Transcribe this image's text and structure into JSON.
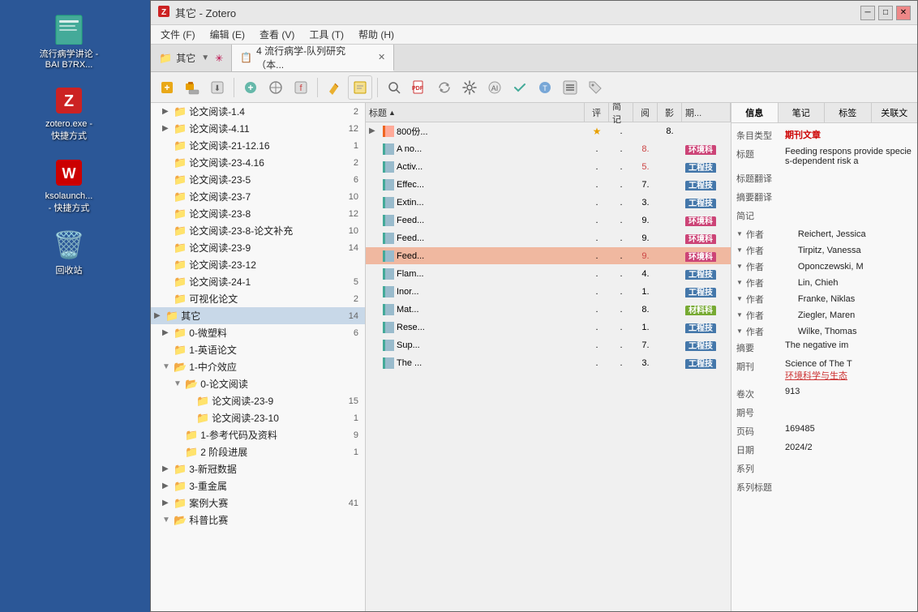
{
  "window": {
    "title": "其它 - Zotero",
    "icon": "Z"
  },
  "menus": [
    {
      "label": "文件 (F)"
    },
    {
      "label": "编辑 (E)"
    },
    {
      "label": "查看 (V)"
    },
    {
      "label": "工具 (T)"
    },
    {
      "label": "帮助 (H)"
    }
  ],
  "tabs": [
    {
      "label": "其它",
      "icon": "📁",
      "active": false,
      "closeable": false,
      "hasDropdown": true
    },
    {
      "label": "4 流行病学-队列研究（本...",
      "icon": "📋",
      "active": true,
      "closeable": true
    }
  ],
  "desktop_icons": [
    {
      "label": "流行病学讲论\n-BAI B7RX...",
      "icon": "📄",
      "color": "#4a7"
    },
    {
      "label": "zotero.exe -\n快捷方式",
      "icon": "Z",
      "special": "zotero"
    },
    {
      "label": "ksolaunch...\n- 快捷方式",
      "icon": "W",
      "special": "wps"
    },
    {
      "label": "回收站",
      "icon": "🗑️"
    }
  ],
  "tree": {
    "items": [
      {
        "level": 1,
        "label": "论文阅读-1.4",
        "count": "2",
        "expanded": false,
        "selected": false,
        "indent": 1
      },
      {
        "level": 1,
        "label": "论文阅读-4.11",
        "count": "12",
        "expanded": false,
        "selected": false,
        "indent": 1
      },
      {
        "level": 1,
        "label": "论文阅读-21-12.16",
        "count": "1",
        "expanded": false,
        "selected": false,
        "indent": 1
      },
      {
        "level": 1,
        "label": "论文阅读-23-4.16",
        "count": "2",
        "expanded": false,
        "selected": false,
        "indent": 1
      },
      {
        "level": 1,
        "label": "论文阅读-23-5",
        "count": "6",
        "expanded": false,
        "selected": false,
        "indent": 1
      },
      {
        "level": 1,
        "label": "论文阅读-23-7",
        "count": "10",
        "expanded": false,
        "selected": false,
        "indent": 1
      },
      {
        "level": 1,
        "label": "论文阅读-23-8",
        "count": "12",
        "expanded": false,
        "selected": false,
        "indent": 1
      },
      {
        "level": 1,
        "label": "论文阅读-23-8-论文补充",
        "count": "10",
        "expanded": false,
        "selected": false,
        "indent": 1
      },
      {
        "level": 1,
        "label": "论文阅读-23-9",
        "count": "14",
        "expanded": false,
        "selected": false,
        "indent": 1
      },
      {
        "level": 1,
        "label": "论文阅读-23-12",
        "count": "",
        "expanded": false,
        "selected": false,
        "indent": 1
      },
      {
        "level": 1,
        "label": "论文阅读-24-1",
        "count": "5",
        "expanded": false,
        "selected": false,
        "indent": 1
      },
      {
        "level": 1,
        "label": "可视化论文",
        "count": "2",
        "expanded": false,
        "selected": false,
        "indent": 1
      },
      {
        "level": 0,
        "label": "其它",
        "count": "14",
        "expanded": false,
        "selected": true,
        "indent": 0
      },
      {
        "level": 1,
        "label": "0-微塑料",
        "count": "6",
        "expanded": false,
        "selected": false,
        "indent": 1
      },
      {
        "level": 1,
        "label": "1-英语论文",
        "count": "",
        "expanded": false,
        "selected": false,
        "indent": 1
      },
      {
        "level": 1,
        "label": "1-中介效应",
        "count": "",
        "expanded": true,
        "selected": false,
        "indent": 1
      },
      {
        "level": 2,
        "label": "0-论文阅读",
        "count": "",
        "expanded": true,
        "selected": false,
        "indent": 2
      },
      {
        "level": 3,
        "label": "论文阅读-23-9",
        "count": "15",
        "expanded": false,
        "selected": false,
        "indent": 3
      },
      {
        "level": 3,
        "label": "论文阅读-23-10",
        "count": "1",
        "expanded": false,
        "selected": false,
        "indent": 3
      },
      {
        "level": 2,
        "label": "1-参考代码及资料",
        "count": "9",
        "expanded": false,
        "selected": false,
        "indent": 2
      },
      {
        "level": 2,
        "label": "2 阶段进展",
        "count": "1",
        "expanded": false,
        "selected": false,
        "indent": 2
      },
      {
        "level": 1,
        "label": "3-新冠数据",
        "count": "",
        "expanded": false,
        "selected": false,
        "indent": 1
      },
      {
        "level": 1,
        "label": "3-重金属",
        "count": "",
        "expanded": false,
        "selected": false,
        "indent": 1
      },
      {
        "level": 1,
        "label": "案例大赛",
        "count": "41",
        "expanded": false,
        "selected": false,
        "indent": 1
      },
      {
        "level": 1,
        "label": "科普比赛",
        "count": "",
        "expanded": true,
        "selected": false,
        "indent": 1
      }
    ]
  },
  "list": {
    "columns": [
      {
        "label": "标题",
        "key": "title",
        "sortable": true,
        "sorted": true,
        "sortDir": "asc"
      },
      {
        "label": "评",
        "key": "rating"
      },
      {
        "label": "简记",
        "key": "note"
      },
      {
        "label": "阅",
        "key": "read"
      },
      {
        "label": "影",
        "key": "attach"
      },
      {
        "label": "期...",
        "key": "journal"
      }
    ],
    "items": [
      {
        "title": "800份...",
        "expand": true,
        "icon": "orange",
        "rating": "★",
        "note": ".",
        "read": "",
        "readDot": false,
        "attach": "8.",
        "journal": "",
        "tag": null,
        "selected": false
      },
      {
        "title": "A no...",
        "expand": false,
        "icon": "green",
        "rating": ".",
        "note": ".",
        "read": "8.",
        "readDot": true,
        "attach": "",
        "journal": "环境科",
        "tag": "env",
        "selected": false
      },
      {
        "title": "Activ...",
        "expand": false,
        "icon": "green",
        "rating": ".",
        "note": ".",
        "read": "5.",
        "readDot": true,
        "attach": "",
        "journal": "工程技",
        "tag": "eng",
        "selected": false
      },
      {
        "title": "Effec...",
        "expand": false,
        "icon": "green",
        "rating": ".",
        "note": ".",
        "read": "7.",
        "readDot": false,
        "attach": "",
        "journal": "工程技",
        "tag": "eng",
        "selected": false
      },
      {
        "title": "Extin...",
        "expand": false,
        "icon": "green",
        "rating": ".",
        "note": ".",
        "read": "3.",
        "readDot": false,
        "attach": "",
        "journal": "工程技",
        "tag": "eng",
        "selected": false
      },
      {
        "title": "Feed...",
        "expand": false,
        "icon": "green",
        "rating": ".",
        "note": ".",
        "read": "9.",
        "readDot": false,
        "attach": "",
        "journal": "环境科",
        "tag": "env",
        "selected": false
      },
      {
        "title": "Feed...",
        "expand": false,
        "icon": "green",
        "rating": ".",
        "note": ".",
        "read": "9.",
        "readDot": false,
        "attach": "",
        "journal": "环境科",
        "tag": "env",
        "selected": false
      },
      {
        "title": "Feed...",
        "expand": false,
        "icon": "green",
        "rating": ".",
        "note": ".",
        "read": "9.",
        "readDot": true,
        "attach": "",
        "journal": "环境科",
        "tag": "env",
        "selected": true
      },
      {
        "title": "Flam...",
        "expand": false,
        "icon": "green",
        "rating": ".",
        "note": ".",
        "read": "4.",
        "readDot": false,
        "attach": "",
        "journal": "工程技",
        "tag": "eng",
        "selected": false
      },
      {
        "title": "Inor...",
        "expand": false,
        "icon": "green",
        "rating": ".",
        "note": ".",
        "read": "1.",
        "readDot": false,
        "attach": "",
        "journal": "工程技",
        "tag": "eng",
        "selected": false
      },
      {
        "title": "Mat...",
        "expand": false,
        "icon": "green",
        "rating": ".",
        "note": ".",
        "read": "8.",
        "readDot": false,
        "attach": "",
        "journal": "材料科",
        "tag": "mat",
        "selected": false
      },
      {
        "title": "Rese...",
        "expand": false,
        "icon": "green",
        "rating": ".",
        "note": ".",
        "read": "1.",
        "readDot": false,
        "attach": "",
        "journal": "工程技",
        "tag": "eng",
        "selected": false
      },
      {
        "title": "Sup...",
        "expand": false,
        "icon": "green",
        "rating": ".",
        "note": ".",
        "read": "7.",
        "readDot": false,
        "attach": "",
        "journal": "工程技",
        "tag": "eng",
        "selected": false
      },
      {
        "title": "The ...",
        "expand": false,
        "icon": "green",
        "rating": ".",
        "note": ".",
        "read": "3.",
        "readDot": false,
        "attach": "",
        "journal": "工程技",
        "tag": "eng",
        "selected": false
      }
    ]
  },
  "detail": {
    "tabs": [
      "信息",
      "笔记",
      "标签",
      "关联文"
    ],
    "active_tab": "信息",
    "item_type_label": "条目类型",
    "item_type_value": "期刊文章",
    "title_label": "标题",
    "title_value": "Feeding respons provide species-dependent risk a",
    "title_trans_label": "标题翻译",
    "abstract_trans_label": "摘要翻译",
    "note_label": "简记",
    "authors": [
      {
        "label": "作者",
        "value": "Reichert, Jessica"
      },
      {
        "label": "作者",
        "value": "Tirpitz, Vanessa"
      },
      {
        "label": "作者",
        "value": "Oponczewski, M"
      },
      {
        "label": "作者",
        "value": "Lin, Chieh"
      },
      {
        "label": "作者",
        "value": "Franke, Niklas"
      },
      {
        "label": "作者",
        "value": "Ziegler, Maren"
      },
      {
        "label": "作者",
        "value": "Wilke, Thomas"
      }
    ],
    "abstract_label": "摘要",
    "abstract_value": "The negative im",
    "journal_label": "期刊",
    "journal_value": "Science of The T",
    "journal_cn": "环境科学与生态",
    "volume_label": "卷次",
    "volume_value": "913",
    "issue_label": "期号",
    "issue_value": "",
    "pages_label": "页码",
    "pages_value": "169485",
    "date_label": "日期",
    "date_value": "2024/2",
    "series_label": "系列",
    "series_value": "",
    "series_title_label": "系列标题",
    "series_title_value": ""
  }
}
